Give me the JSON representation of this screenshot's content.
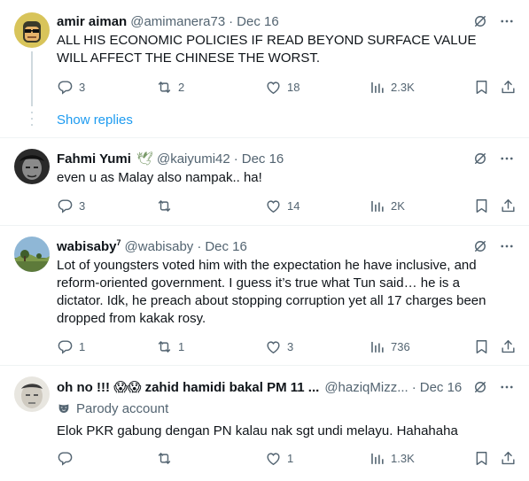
{
  "tweets": [
    {
      "name": "amir aiman",
      "handle": "@amimanera73",
      "date": "Dec 16",
      "text": "ALL HIS ECONOMIC POLICIES IF READ BEYOND SURFACE VALUE WILL AFFECT THE CHINESE THE WORST.",
      "replies": "3",
      "retweets": "2",
      "likes": "18",
      "views": "2.3K",
      "avatar_icon": "cartoon-face-avatar"
    },
    {
      "name": "Fahmi Yumi",
      "name_emoji": "🕊",
      "handle": "@kaiyumi42",
      "date": "Dec 16",
      "text": "even u as Malay also nampak.. ha!",
      "replies": "3",
      "retweets": "",
      "likes": "14",
      "views": "2K",
      "avatar_icon": "bw-photo-avatar"
    },
    {
      "name": "wabisaby",
      "name_sup": "7",
      "handle": "@wabisaby",
      "date": "Dec 16",
      "text": "Lot of youngsters voted him with the expectation he have inclusive, and reform-oriented government. I guess it’s true what Tun said… he is a dictator. Idk, he preach about stopping corruption yet all 17 charges been dropped from kakak rosy.",
      "replies": "1",
      "retweets": "1",
      "likes": "3",
      "views": "736",
      "avatar_icon": "landscape-avatar"
    },
    {
      "name": "oh no !!! 😱😱 zahid hamidi bakal PM 11 ...",
      "handle": "@haziqMizz...",
      "date": "Dec 16",
      "parody_label": "Parody account",
      "text": "Elok PKR gabung dengan PN kalau nak sgt undi melayu. Hahahaha",
      "replies": "",
      "retweets": "",
      "likes": "1",
      "views": "1.3K",
      "avatar_icon": "face-photo-avatar"
    }
  ],
  "show_replies": "Show replies",
  "colors": {
    "text": "#0f1419",
    "secondary": "#536471",
    "link": "#1d9bf0",
    "divider": "#eff3f4"
  },
  "icons": {
    "grok": "slashed-circle-icon",
    "more": "more-dots-icon",
    "reply": "reply-icon",
    "retweet": "retweet-icon",
    "like": "heart-icon",
    "views": "views-chart-icon",
    "bookmark": "bookmark-icon",
    "share": "share-icon",
    "parody": "mask-icon"
  }
}
